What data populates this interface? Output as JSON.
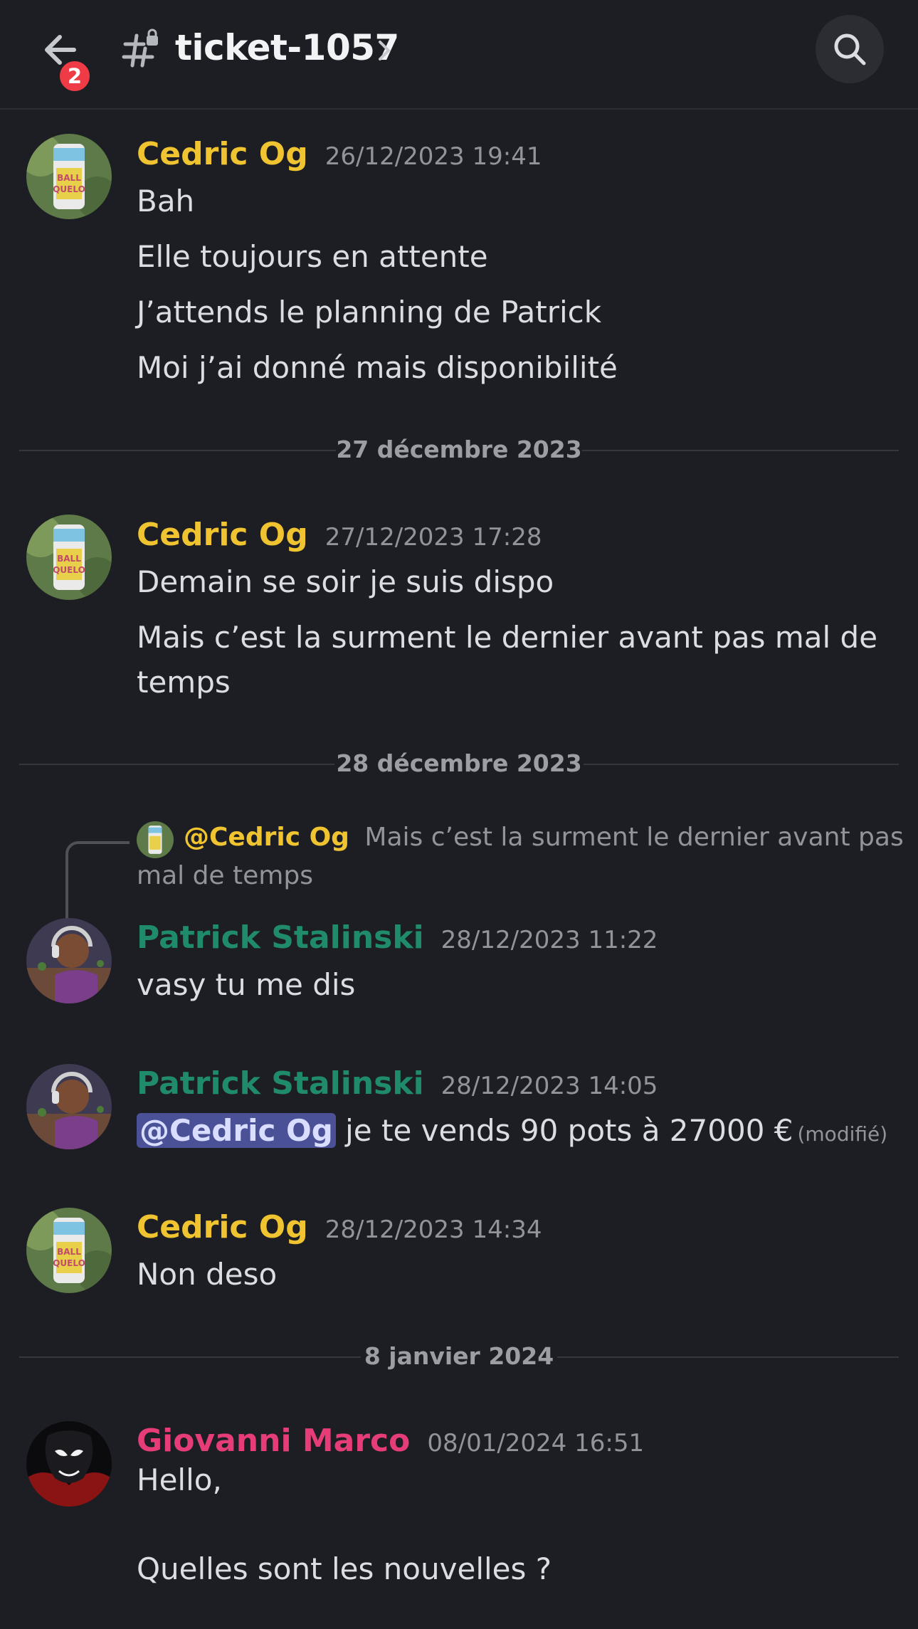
{
  "header": {
    "badge_count": "2",
    "channel_name": "ticket-1057",
    "chevron": "›"
  },
  "colors": {
    "background": "#1d1e23",
    "cedric": "#f0c330",
    "patrick": "#1f8b6b",
    "giovanni": "#e63d78",
    "mention_bg": "#4a5196",
    "badge": "#ef3b45"
  },
  "icons": {
    "back": "back-arrow-icon",
    "channel": "locked-hash-icon",
    "search": "search-icon"
  },
  "messages": [
    {
      "author": "Cedric Og",
      "timestamp": "26/12/2023 19:41",
      "lines": [
        "Bah",
        "Elle toujours en attente",
        "J’attends le planning de Patrick",
        "Moi j’ai donné mais disponibilité"
      ]
    },
    {
      "author": "Cedric Og",
      "timestamp": "27/12/2023 17:28",
      "lines": [
        "Demain se soir je suis dispo",
        "Mais c’est la surment le dernier avant pas mal de",
        "temps"
      ]
    },
    {
      "reply": {
        "author": "@Cedric Og",
        "text_line1": "Mais c’est la surment le dernier avant pas",
        "text_line2": "mal de temps"
      },
      "author": "Patrick Stalinski",
      "timestamp": "28/12/2023 11:22",
      "lines": [
        "vasy tu me dis"
      ]
    },
    {
      "author": "Patrick Stalinski",
      "timestamp": "28/12/2023 14:05",
      "mention": "@Cedric Og",
      "text": "je te vends 90 pots à 27000 €",
      "edited": "(modifié)"
    },
    {
      "author": "Cedric Og",
      "timestamp": "28/12/2023 14:34",
      "lines": [
        "Non deso"
      ]
    },
    {
      "author": "Giovanni Marco",
      "timestamp": "08/01/2024 16:51",
      "lines": [
        "Hello,",
        "Quelles sont les nouvelles ?"
      ]
    }
  ],
  "dividers": [
    "27 décembre 2023",
    "28 décembre 2023",
    "8 janvier 2024"
  ]
}
